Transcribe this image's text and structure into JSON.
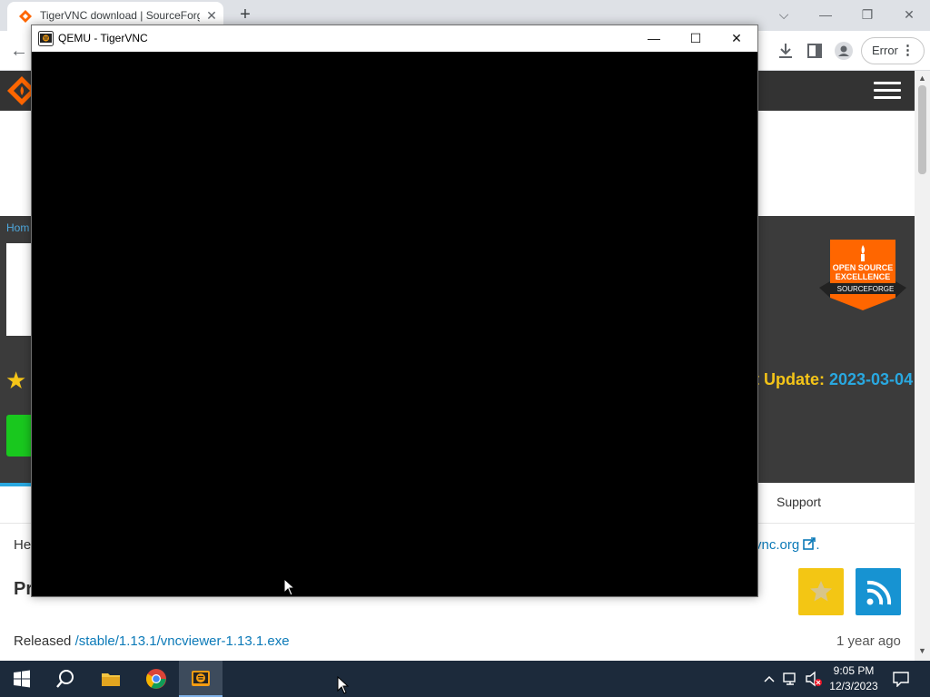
{
  "browser": {
    "tab_title": "TigerVNC download | SourceForge.net",
    "tab_close": "✕",
    "new_tab": "+",
    "window_controls": {
      "dropdown": "⌵",
      "minimize": "—",
      "restore": "❐",
      "close": "✕"
    },
    "back": "←",
    "error_chip": "Error",
    "error_menu": "⋮"
  },
  "page": {
    "breadcrumb": "Hom",
    "last_update_label": "t Update: ",
    "last_update_date": "2023-03-04",
    "nav_support": "Support",
    "help_prefix": "He",
    "home_link": "vnc.org",
    "project_activity": "Pr",
    "released_label": "Released",
    "released_file": "/stable/1.13.1/vncviewer-1.13.1.exe",
    "released_ago": "1 year ago",
    "badge": {
      "line1": "OPEN SOURCE",
      "line2": "EXCELLENCE",
      "brand": "SOURCEFORGE"
    }
  },
  "vnc": {
    "title": "QEMU - TigerVNC",
    "controls": {
      "minimize": "—",
      "maximize": "☐",
      "close": "✕"
    }
  },
  "taskbar": {
    "time": "9:05 PM",
    "date": "12/3/2023"
  },
  "colors": {
    "sf_orange": "#ff6600",
    "sf_dark": "#333333",
    "last_update_yellow": "#f5c518",
    "link_blue": "#0c7ab8",
    "taskbar": "#1c2a3b"
  }
}
